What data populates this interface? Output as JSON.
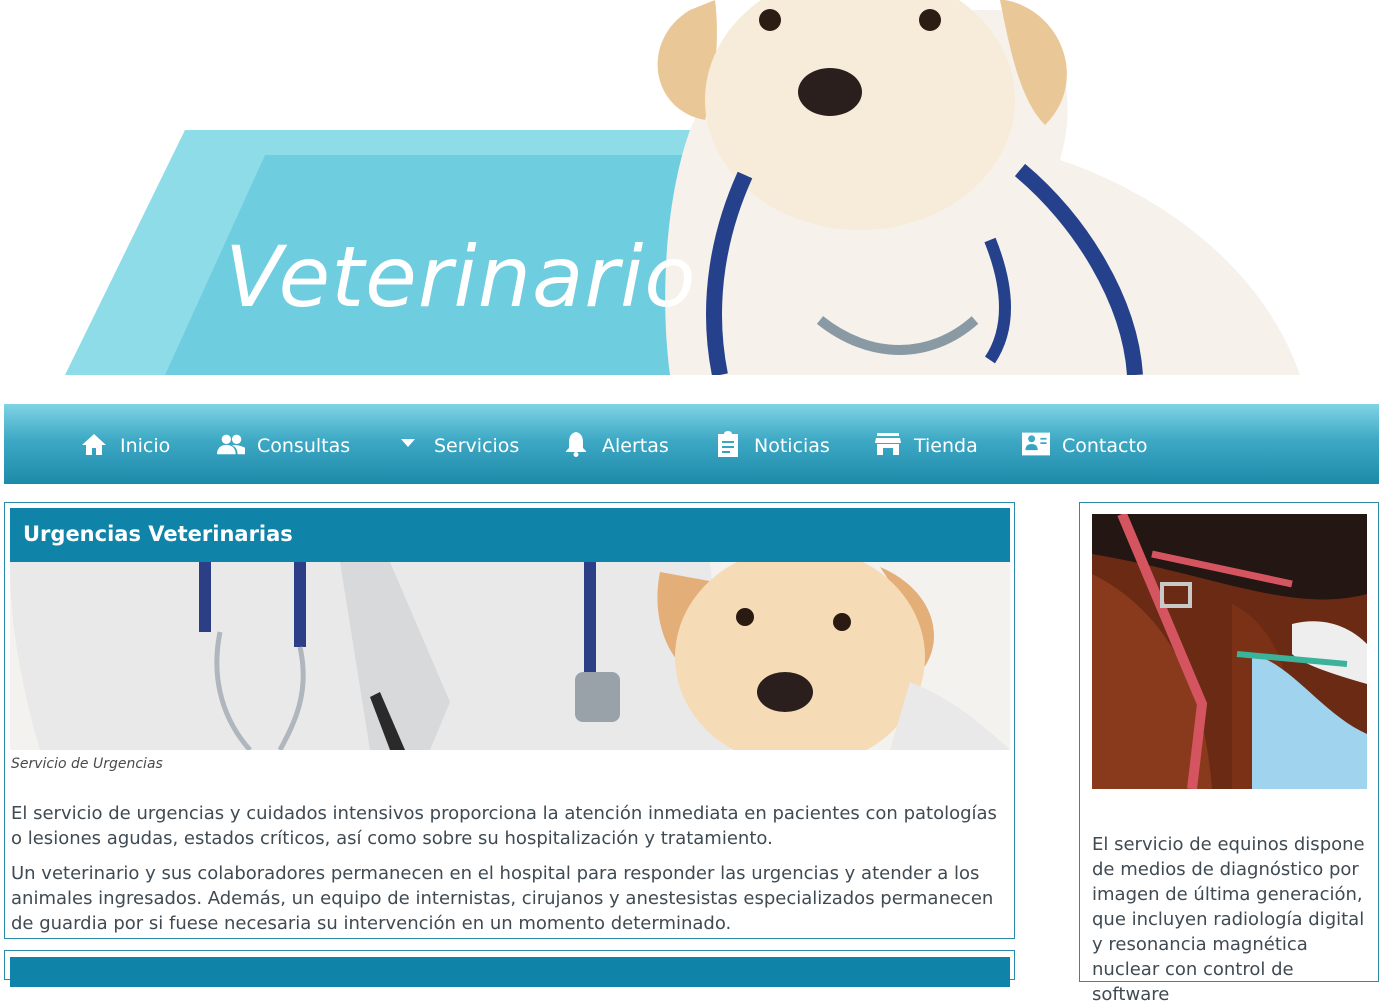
{
  "banner": {
    "title": "Veterinario",
    "accent_color": "#78d0e1"
  },
  "nav": {
    "items": [
      {
        "label": "Inicio",
        "icon": "home-icon"
      },
      {
        "label": "Consultas",
        "icon": "people-icon"
      },
      {
        "label": "Servicios",
        "icon": "caret-down-icon"
      },
      {
        "label": "Alertas",
        "icon": "bell-icon"
      },
      {
        "label": "Noticias",
        "icon": "clipboard-icon"
      },
      {
        "label": "Tienda",
        "icon": "store-icon"
      },
      {
        "label": "Contacto",
        "icon": "contact-card-icon"
      }
    ],
    "color": "#1d8aa9"
  },
  "article": {
    "title": "Urgencias Veterinarias",
    "caption": "Servicio de Urgencias",
    "paragraphs": [
      "El servicio de urgencias y cuidados intensivos proporciona la atención inmediata en pacientes con patologías o lesiones agudas, estados críticos, así como sobre su hospitalización y tratamiento.",
      "Un veterinario y sus colaboradores permanecen en el hospital para responder las urgencias y atender a los animales ingresados. Además, un equipo de internistas, cirujanos y anestesistas especializados permanecen de guardia por si fuese necesaria su intervención en un momento determinado."
    ],
    "header_color": "#0f84a8"
  },
  "sidebar": {
    "text": "El servicio de equinos dispone de medios de diagnóstico por imagen de última generación, que incluyen radiología digital y resonancia magnética nuclear con control de software"
  }
}
